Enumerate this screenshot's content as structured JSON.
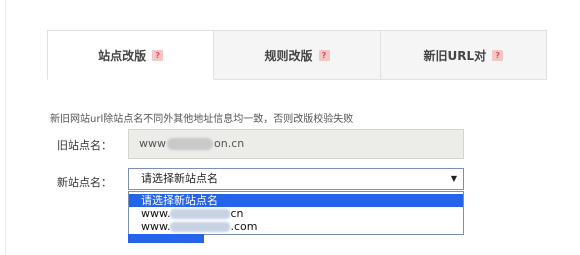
{
  "tabs": [
    {
      "label": "站点改版",
      "help": "?"
    },
    {
      "label": "规则改版",
      "help": "?"
    },
    {
      "label": "新旧URL对",
      "help": "?"
    }
  ],
  "hint": "新旧网站url除站点名不同外其他地址信息均一致，否则改版校验失败",
  "old_site": {
    "label": "旧站点名：",
    "value_prefix": "www",
    "value_suffix": "on.cn"
  },
  "new_site": {
    "label": "新站点名：",
    "selected": "请选择新站点名",
    "arrow": "▼",
    "options": [
      {
        "label": "请选择新站点名"
      },
      {
        "prefix": "www.",
        "suffix": "cn"
      },
      {
        "prefix": "www.",
        "suffix": ".com"
      }
    ]
  },
  "colors": {
    "accent": "#2563eb",
    "help_bg": "#f5c6c6",
    "help_fg": "#d9534f"
  }
}
